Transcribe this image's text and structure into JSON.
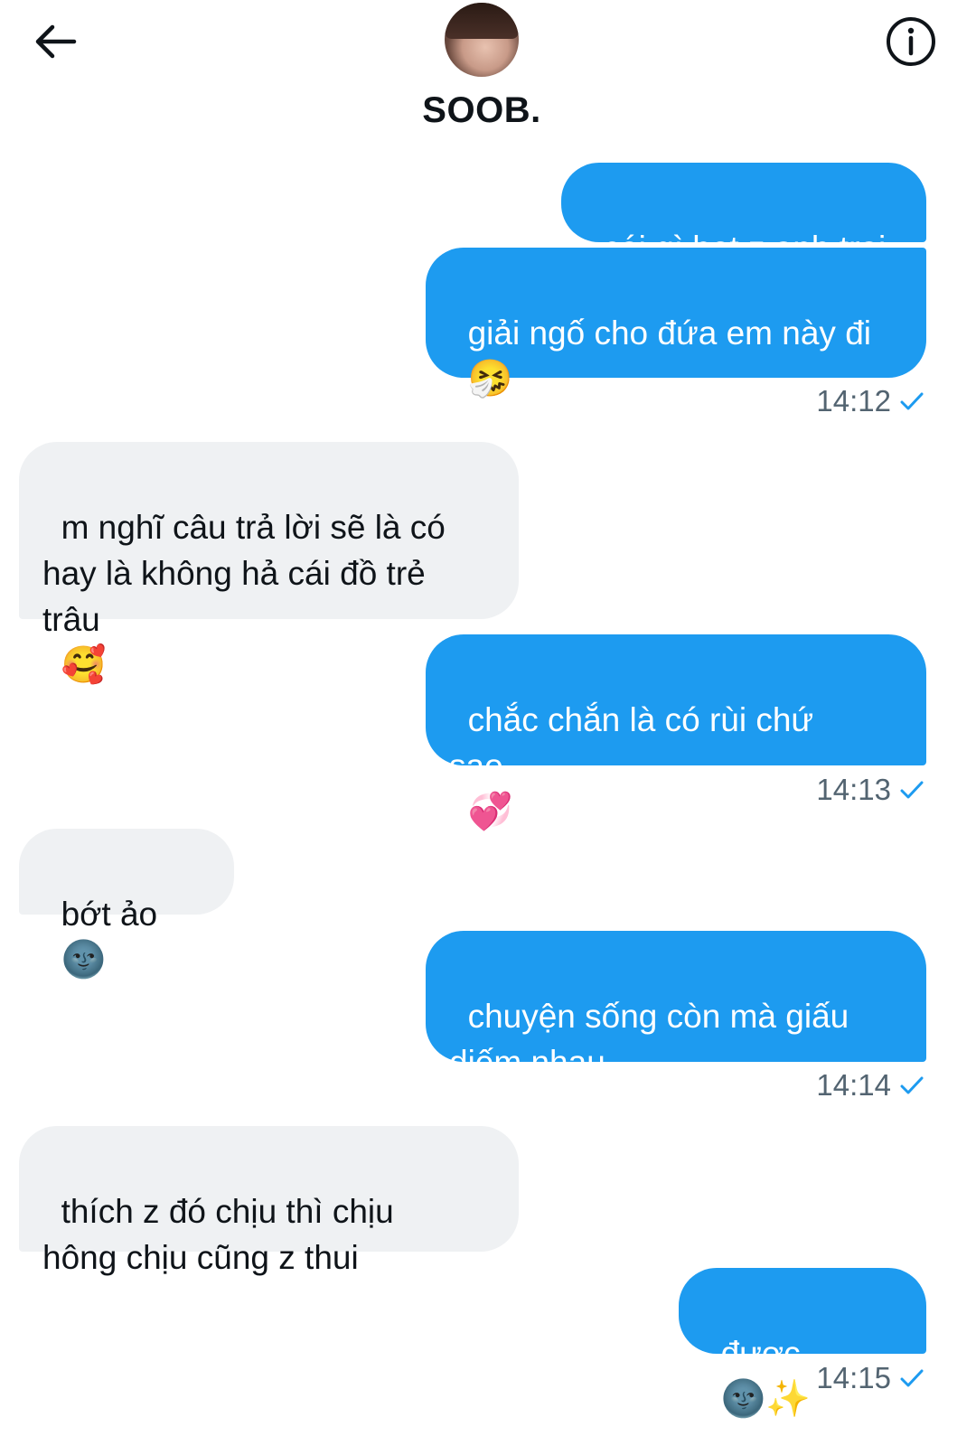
{
  "header": {
    "name": "SOOB."
  },
  "messages": [
    {
      "text": "cái gì hot z anh trai"
    },
    {
      "text": "giải ngố cho đứa em này đi",
      "emoji": "🤧"
    },
    {
      "time": "14:12"
    },
    {
      "text": "m nghĩ câu trả lời sẽ là có\nhay là không hả cái đồ trẻ\ntrâu",
      "emoji": "🥰"
    },
    {
      "text": "chắc chắn là có rùi chứ\nsao",
      "emoji": "💞"
    },
    {
      "time": "14:13"
    },
    {
      "text": "bớt ảo",
      "emoji": "🌚"
    },
    {
      "text": "chuyện sống còn mà giấu\ndiếm nhau",
      "emoji": "😇"
    },
    {
      "time": "14:14"
    },
    {
      "text": "thích z đó chịu thì chịu\nhông chịu cũng z thui"
    },
    {
      "text": "được",
      "emoji": "🌚✨"
    },
    {
      "time": "14:15"
    }
  ],
  "colors": {
    "outgoing_bubble": "#1d9bf0",
    "incoming_bubble": "#eff1f3",
    "read_check": "#1d9bf0"
  },
  "icons": [
    "back-arrow-icon",
    "info-icon",
    "read-check-icon"
  ]
}
